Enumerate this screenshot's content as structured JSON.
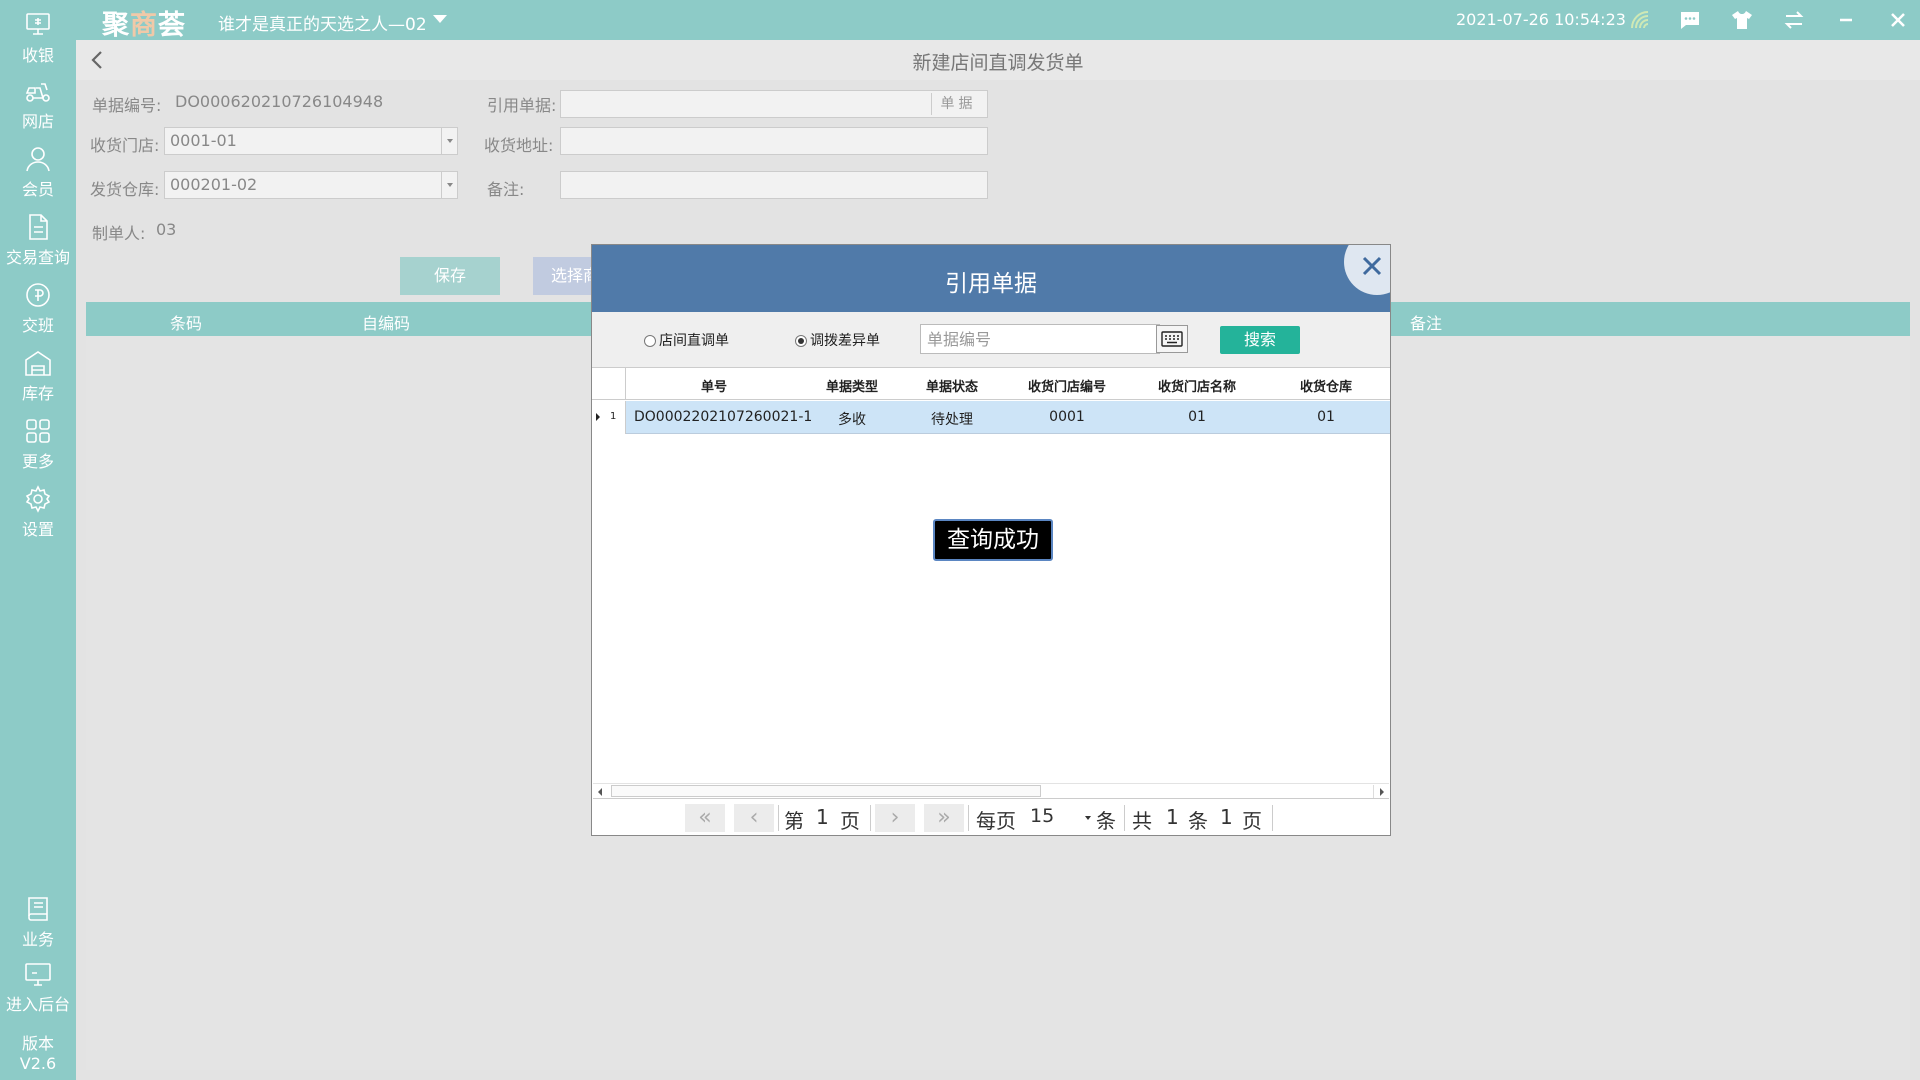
{
  "sidebar": {
    "items": [
      {
        "label": "收银",
        "icon": "cash-register-icon"
      },
      {
        "label": "网店",
        "icon": "delivery-scooter-icon"
      },
      {
        "label": "会员",
        "icon": "member-icon"
      },
      {
        "label": "交易查询",
        "icon": "document-icon"
      },
      {
        "label": "交班",
        "icon": "shift-icon"
      },
      {
        "label": "库存",
        "icon": "warehouse-icon"
      },
      {
        "label": "更多",
        "icon": "grid-icon"
      },
      {
        "label": "设置",
        "icon": "gear-icon"
      },
      {
        "label": "业务",
        "icon": "book-icon"
      },
      {
        "label": "进入后台",
        "icon": "monitor-icon"
      }
    ],
    "version_label": "版本",
    "version": "V2.6"
  },
  "topbar": {
    "logo_a": "聚",
    "logo_b": "商",
    "logo_c": "荟",
    "store_name": "谁才是真正的天选之人—02",
    "datetime": "2021-07-26 10:54:23"
  },
  "page": {
    "title": "新建店间直调发货单"
  },
  "form": {
    "doc_no_label": "单据编号:",
    "doc_no": "DO000620210726104948",
    "ref_doc_label": "引用单据:",
    "ref_doc_button": "单据",
    "receive_store_label": "收货门店:",
    "receive_store": "0001-01",
    "receive_addr_label": "收货地址:",
    "ship_wh_label": "发货仓库:",
    "ship_wh": "000201-02",
    "remark_label": "备注:",
    "creator_label": "制单人:",
    "creator": "03",
    "save_label": "保存",
    "select_label": "选择商"
  },
  "grid": {
    "columns": [
      "条码",
      "自编码",
      "备注"
    ]
  },
  "modal": {
    "title": "引用单据",
    "radio_1": "店间直调单",
    "radio_2": "调拨差异单",
    "selected_radio": 2,
    "search_placeholder": "单据编号",
    "search_button": "搜索",
    "columns": [
      "单号",
      "单据类型",
      "单据状态",
      "收货门店编号",
      "收货门店名称",
      "收货仓库"
    ],
    "rows": [
      {
        "index": "1",
        "cells": [
          "DO0002202107260021-1",
          "多收",
          "待处理",
          "0001",
          "01",
          "01"
        ]
      }
    ],
    "toast": "查询成功",
    "pager": {
      "page_prefix": "第",
      "page": "1",
      "page_suffix": "页",
      "per_page_label": "每页",
      "per_page": "15",
      "per_page_unit": "条",
      "total_prefix": "共",
      "total_items": "1",
      "total_items_unit": "条",
      "total_pages": "1",
      "total_pages_unit": "页"
    }
  }
}
